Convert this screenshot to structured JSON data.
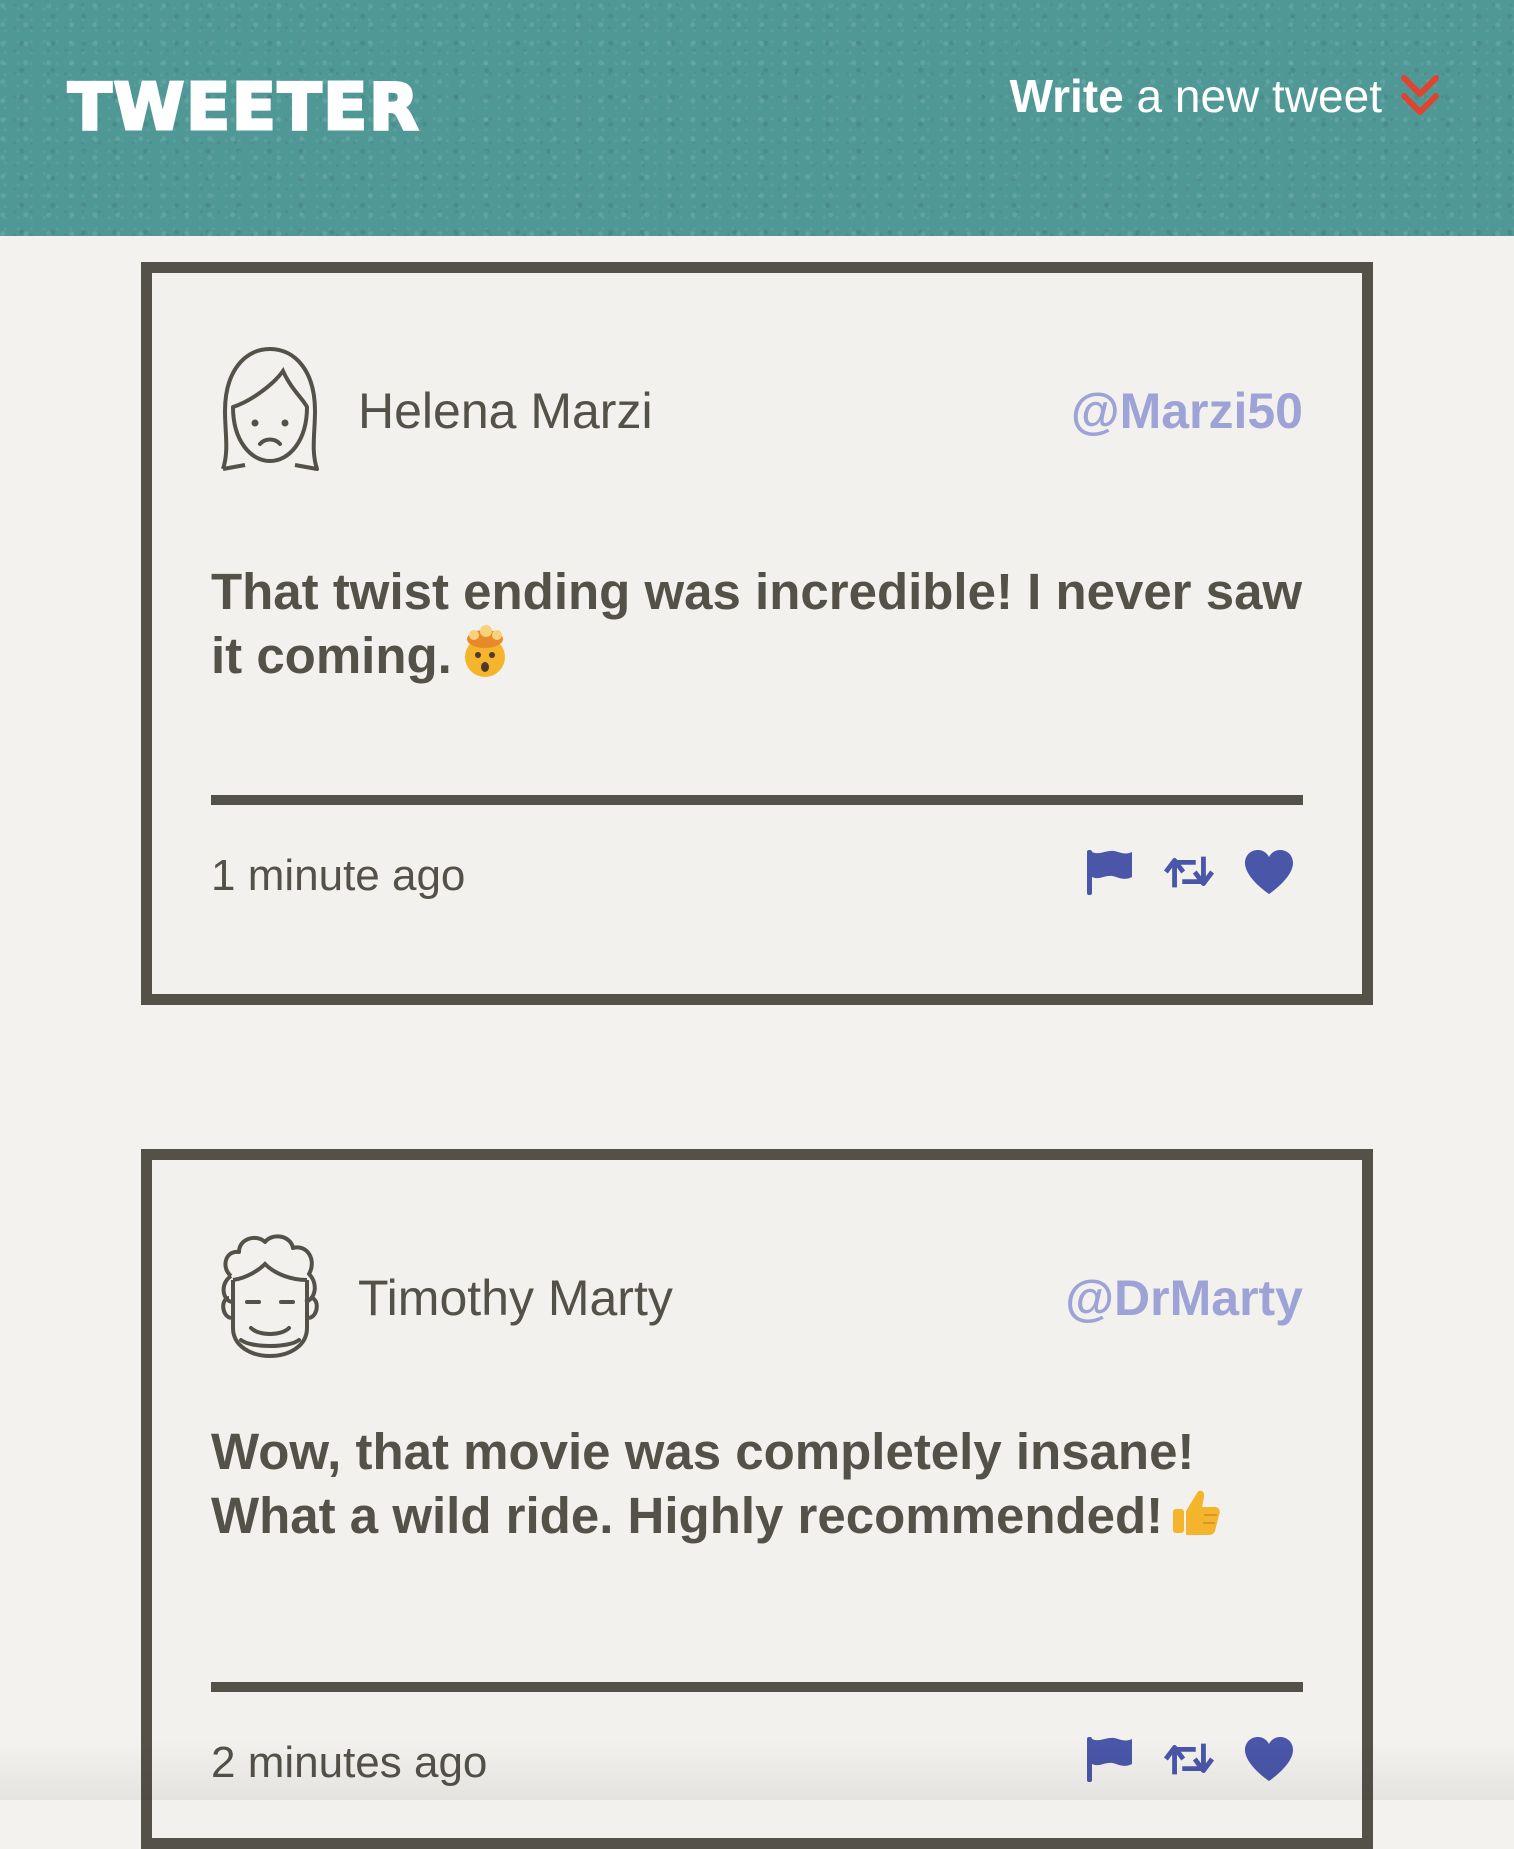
{
  "header": {
    "brand": "TWEETER",
    "compose_strong": "Write",
    "compose_rest": "a new tweet",
    "compose_icon": "double-chevron-down-icon"
  },
  "colors": {
    "header_bg": "#4f9896",
    "page_bg": "#f4f2ee",
    "ink": "#545149",
    "handle": "#9da3d6",
    "action": "#4a56a8",
    "chevron": "#e0442e"
  },
  "tweets": [
    {
      "name": "Helena Marzi",
      "handle": "@Marzi50",
      "text": "That twist ending was incredible! I never saw it coming.",
      "emoji": "exploding-head-emoji",
      "time": "1 minute ago",
      "avatar": "woman-avatar-icon"
    },
    {
      "name": "Timothy Marty",
      "handle": "@DrMarty",
      "text": "Wow, that movie was completely insane! What a wild ride. Highly recommended!",
      "emoji": "thumbs-up-emoji",
      "time": "2 minutes ago",
      "avatar": "curly-man-avatar-icon"
    }
  ],
  "actions": [
    "flag-icon",
    "retweet-icon",
    "heart-icon"
  ]
}
